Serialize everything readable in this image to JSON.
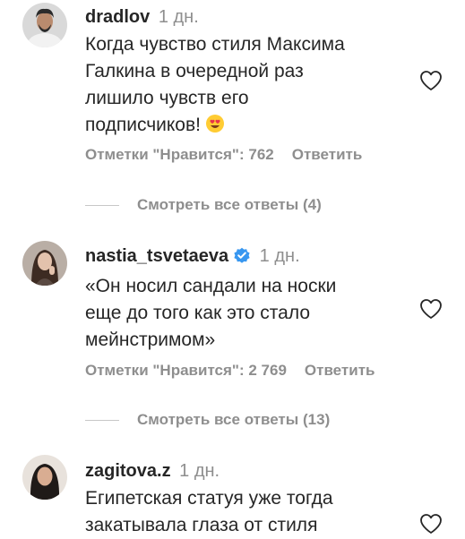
{
  "comments": [
    {
      "username": "dradlov",
      "time": "1 дн.",
      "verified": false,
      "lines": [
        "Когда чувство стиля Максима",
        "Галкина в очередной раз",
        "лишило чувств его",
        "подписчиков!"
      ],
      "emoji": "heart-eyes-emoji",
      "likes": "Отметки \"Нравится\": 762",
      "reply": "Ответить",
      "view_replies": "Смотреть все ответы (4)"
    },
    {
      "username": "nastia_tsvetaeva",
      "time": "1 дн.",
      "verified": true,
      "lines": [
        "«Он носил сандали на носки",
        "еще до того как это стало",
        "мейнстримом»"
      ],
      "likes": "Отметки \"Нравится\": 2 769",
      "reply": "Ответить",
      "view_replies": "Смотреть все ответы (13)"
    },
    {
      "username": "zagitova.z",
      "time": "1 дн.",
      "verified": false,
      "lines": [
        "Египетская статуя уже тогда",
        "закатывала глаза от стиля"
      ]
    }
  ],
  "colors": {
    "text": "#262626",
    "secondary": "#8e8e8e",
    "verified": "#3897f0"
  },
  "icons": {
    "like": "heart-outline-icon",
    "verified": "verified-badge-icon"
  }
}
